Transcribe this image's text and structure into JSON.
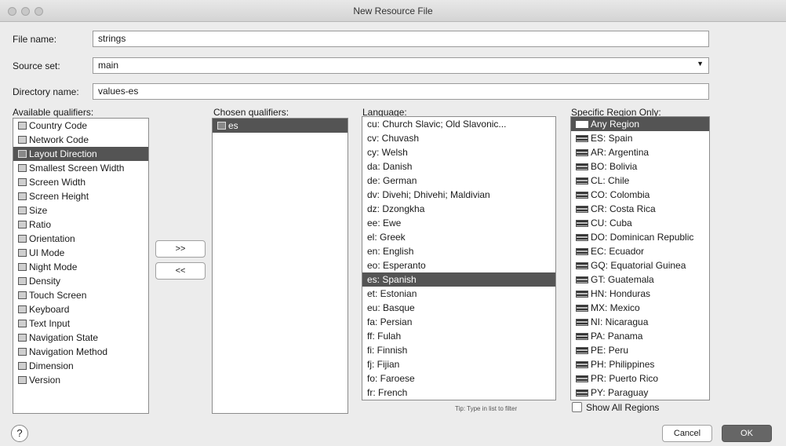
{
  "window": {
    "title": "New Resource File"
  },
  "form": {
    "file_name_label": "File name:",
    "file_name_value": "strings",
    "source_set_label": "Source set:",
    "source_set_value": "main",
    "directory_label": "Directory name:",
    "directory_value": "values-es"
  },
  "available": {
    "heading": "Available qualifiers:",
    "items": [
      {
        "label": "Country Code",
        "icon": "globe-icon"
      },
      {
        "label": "Network Code",
        "icon": "network-icon"
      },
      {
        "label": "Layout Direction",
        "icon": "layout-direction-icon",
        "selected": true
      },
      {
        "label": "Smallest Screen Width",
        "icon": "screen-width-icon"
      },
      {
        "label": "Screen Width",
        "icon": "screen-width-icon"
      },
      {
        "label": "Screen Height",
        "icon": "screen-height-icon"
      },
      {
        "label": "Size",
        "icon": "size-icon"
      },
      {
        "label": "Ratio",
        "icon": "ratio-icon"
      },
      {
        "label": "Orientation",
        "icon": "orientation-icon"
      },
      {
        "label": "UI Mode",
        "icon": "ui-mode-icon"
      },
      {
        "label": "Night Mode",
        "icon": "night-mode-icon"
      },
      {
        "label": "Density",
        "icon": "density-icon"
      },
      {
        "label": "Touch Screen",
        "icon": "touch-screen-icon"
      },
      {
        "label": "Keyboard",
        "icon": "keyboard-icon"
      },
      {
        "label": "Text Input",
        "icon": "text-input-icon"
      },
      {
        "label": "Navigation State",
        "icon": "navigation-state-icon"
      },
      {
        "label": "Navigation Method",
        "icon": "navigation-method-icon"
      },
      {
        "label": "Dimension",
        "icon": "dimension-icon"
      },
      {
        "label": "Version",
        "icon": "android-icon"
      }
    ]
  },
  "transfer": {
    "add_label": ">>",
    "remove_label": "<<"
  },
  "chosen": {
    "heading": "Chosen qualifiers:",
    "items": [
      {
        "label": "es",
        "icon": "globe-icon",
        "selected": true
      }
    ]
  },
  "language": {
    "heading": "Language:",
    "items": [
      {
        "label": "cu: Church Slavic; Old Slavonic..."
      },
      {
        "label": "cv: Chuvash"
      },
      {
        "label": "cy: Welsh"
      },
      {
        "label": "da: Danish"
      },
      {
        "label": "de: German"
      },
      {
        "label": "dv: Divehi; Dhivehi; Maldivian"
      },
      {
        "label": "dz: Dzongkha"
      },
      {
        "label": "ee: Ewe"
      },
      {
        "label": "el: Greek"
      },
      {
        "label": "en: English"
      },
      {
        "label": "eo: Esperanto"
      },
      {
        "label": "es: Spanish",
        "selected": true
      },
      {
        "label": "et: Estonian"
      },
      {
        "label": "eu: Basque"
      },
      {
        "label": "fa: Persian"
      },
      {
        "label": "ff: Fulah"
      },
      {
        "label": "fi: Finnish"
      },
      {
        "label": "fj: Fijian"
      },
      {
        "label": "fo: Faroese"
      },
      {
        "label": "fr: French"
      }
    ],
    "tip": "Tip: Type in list to filter"
  },
  "region": {
    "heading": "Specific Region Only:",
    "items": [
      {
        "label": "Any Region",
        "selected": true
      },
      {
        "label": "ES: Spain"
      },
      {
        "label": "AR: Argentina"
      },
      {
        "label": "BO: Bolivia"
      },
      {
        "label": "CL: Chile"
      },
      {
        "label": "CO: Colombia"
      },
      {
        "label": "CR: Costa Rica"
      },
      {
        "label": "CU: Cuba"
      },
      {
        "label": "DO: Dominican Republic"
      },
      {
        "label": "EC: Ecuador"
      },
      {
        "label": "GQ: Equatorial Guinea"
      },
      {
        "label": "GT: Guatemala"
      },
      {
        "label": "HN: Honduras"
      },
      {
        "label": "MX: Mexico"
      },
      {
        "label": "NI: Nicaragua"
      },
      {
        "label": "PA: Panama"
      },
      {
        "label": "PE: Peru"
      },
      {
        "label": "PH: Philippines"
      },
      {
        "label": "PR: Puerto Rico"
      },
      {
        "label": "PY: Paraguay"
      }
    ],
    "show_all_label": "Show All Regions",
    "show_all_checked": false
  },
  "footer": {
    "help_label": "?",
    "cancel_label": "Cancel",
    "ok_label": "OK"
  }
}
